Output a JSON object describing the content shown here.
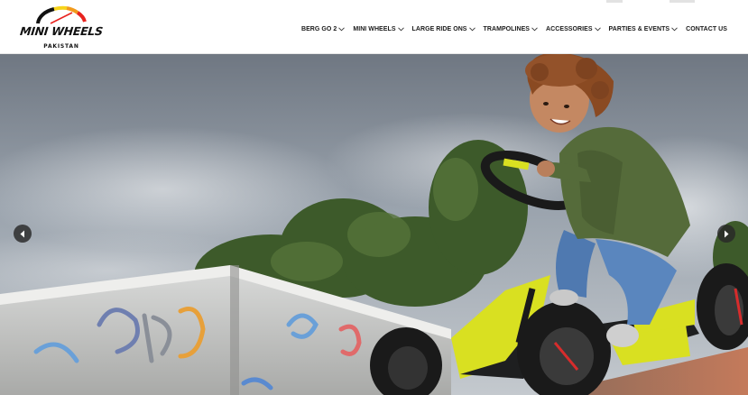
{
  "brand": {
    "name": "MINI WHEELS",
    "subtitle": "PAKISTAN",
    "colors": {
      "arc_red": "#e8231f",
      "arc_orange": "#f29a1c",
      "arc_yellow": "#f7d41b",
      "text": "#111111"
    }
  },
  "nav": {
    "items": [
      {
        "label": "BERG GO 2",
        "has_dropdown": true
      },
      {
        "label": "MINI WHEELS",
        "has_dropdown": true
      },
      {
        "label": "LARGE RIDE ONS",
        "has_dropdown": true
      },
      {
        "label": "TRAMPOLINES",
        "has_dropdown": true
      },
      {
        "label": "ACCESSORIES",
        "has_dropdown": true
      },
      {
        "label": "PARTIES & EVENTS",
        "has_dropdown": true
      },
      {
        "label": "CONTACT US",
        "has_dropdown": false
      }
    ]
  },
  "hero": {
    "prev_icon": "chevron-left-icon",
    "next_icon": "chevron-right-icon",
    "kart_accent": "#d9e021",
    "sky": "#8f9aa6"
  }
}
